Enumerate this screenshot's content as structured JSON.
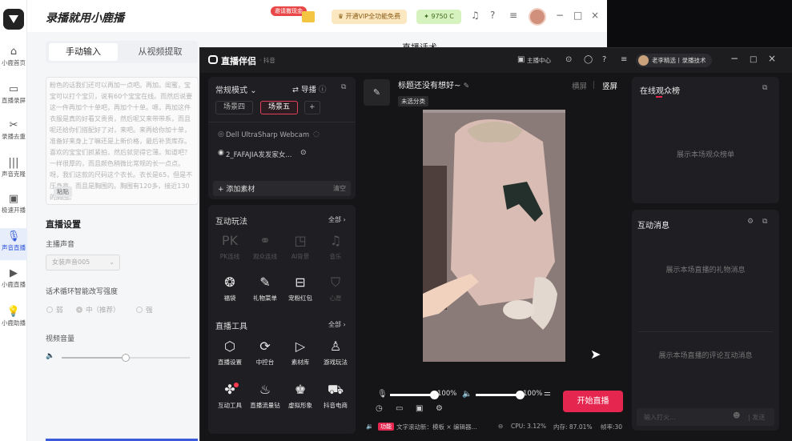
{
  "bg_app": {
    "title": "录播就用小鹿播",
    "promo_badge": "邀请撒现金",
    "vip_label": "开通VIP全功能免费",
    "coins": "9750",
    "coin_suffix": "C",
    "nav": [
      {
        "label": "小鹿首页",
        "icon": "home-icon"
      },
      {
        "label": "直播录屏",
        "icon": "camera-icon"
      },
      {
        "label": "录播去重",
        "icon": "scissors-icon"
      },
      {
        "label": "声音克隆",
        "icon": "waveform-icon"
      },
      {
        "label": "极速开播",
        "icon": "play-screen-icon"
      },
      {
        "label": "声音直播",
        "icon": "microphone-icon"
      },
      {
        "label": "小鹿直播",
        "icon": "play-circle-icon"
      },
      {
        "label": "小鹿助播",
        "icon": "lightbulb-icon"
      }
    ],
    "tabs": {
      "manual": "手动输入",
      "extract": "从视频提取"
    },
    "script_text": "粉色的话我们还可以再加一点吧。再加。闺蜜，宝宝可以打个宝贝，说有60个宝宝在线。而然后说要这一件再加个十单吧，再加个十单。嗯，再加这件衣服是真的好看又贵贵，然后呢又来带带系，而且呢还给你们搭配好了对，来吧。来再给你加十单，准备好来身上了嘛还是上新价格，最后补货库存。喜欢的宝宝们抓紧拍，然后就觉得它薄。知道吧？一样很厚的，而且颜色稍微比常规的长一点点。呀，我们这款的尺码这个衣长。衣长是65，但是不压身高，而且是胸围的。胸围有120多，接近130的胸围。",
    "paste_btn": "粘贴",
    "live_settings": "直播设置",
    "voice_label": "主播声音",
    "voice_value": "女装声音005",
    "rewrite_label": "话术循环智能改写强度",
    "rewrite_options": [
      "弱",
      "中（推荐）",
      "强"
    ],
    "volume_label": "视频音量",
    "volume_level": 0.5,
    "right_title": "直播话术"
  },
  "win": {
    "app_name": "直播伴侣",
    "platform": "抖音",
    "header_menu": "主播中心",
    "user_name": "老李精选丨录播技术",
    "mode_label": "常规模式",
    "import_label": "导播",
    "scenes": [
      "场景四",
      "场景五"
    ],
    "active_scene": 1,
    "sources": [
      {
        "name": "Dell UltraSharp Webcam",
        "icon": "webcam-icon"
      },
      {
        "name": "2_FAFAJIA发发家女...",
        "icon": "video-source-icon"
      }
    ],
    "add_material": "添加素材",
    "clear": "清空",
    "interactive_title": "互动玩法",
    "all": "全部",
    "interactive": [
      {
        "label": "PK连线",
        "icon": "pk-icon",
        "enabled": false
      },
      {
        "label": "观众连线",
        "icon": "link-icon",
        "enabled": false
      },
      {
        "label": "AI背景",
        "icon": "ai-icon",
        "enabled": false
      },
      {
        "label": "音乐",
        "icon": "music-icon",
        "enabled": false
      },
      {
        "label": "福袋",
        "icon": "bag-icon",
        "enabled": true
      },
      {
        "label": "礼物菜单",
        "icon": "gift-menu-icon",
        "enabled": true
      },
      {
        "label": "宠粉红包",
        "icon": "red-packet-icon",
        "enabled": true
      },
      {
        "label": "心愿",
        "icon": "wish-icon",
        "enabled": false
      }
    ],
    "tools_title": "直播工具",
    "tools": [
      {
        "label": "直播设置",
        "icon": "settings-icon"
      },
      {
        "label": "中控台",
        "icon": "console-icon"
      },
      {
        "label": "素材库",
        "icon": "library-icon"
      },
      {
        "label": "游戏玩法",
        "icon": "game-icon"
      },
      {
        "label": "互动工具",
        "icon": "puzzle-icon"
      },
      {
        "label": "直播流量钻",
        "icon": "flame-icon"
      },
      {
        "label": "虚拟形象",
        "icon": "avatar-icon"
      },
      {
        "label": "抖音电商",
        "icon": "cart-icon"
      }
    ],
    "stream_title": "标题还没有想好~",
    "category": "未选分类",
    "orient": {
      "landscape": "横屏",
      "portrait": "竖屏"
    },
    "mic_volume": "100%",
    "speaker_volume": "100%",
    "mic_level": 1.0,
    "speaker_level": 1.0,
    "start_live": "开始直播",
    "status_badge": "功能",
    "status_text": "文字滚动新：模板 × 编辑器...",
    "cpu": "CPU: 3.12%",
    "mem": "内存: 87.01%",
    "fps": "帧率:30",
    "audience_title": "在线观众榜",
    "audience_empty": "展示本场观众榜单",
    "messages_title": "互动消息",
    "gift_empty": "展示本场直播的礼物消息",
    "comment_empty": "展示本场直播的评论互动消息",
    "chat_placeholder": "输入打火...",
    "send": "发送"
  }
}
